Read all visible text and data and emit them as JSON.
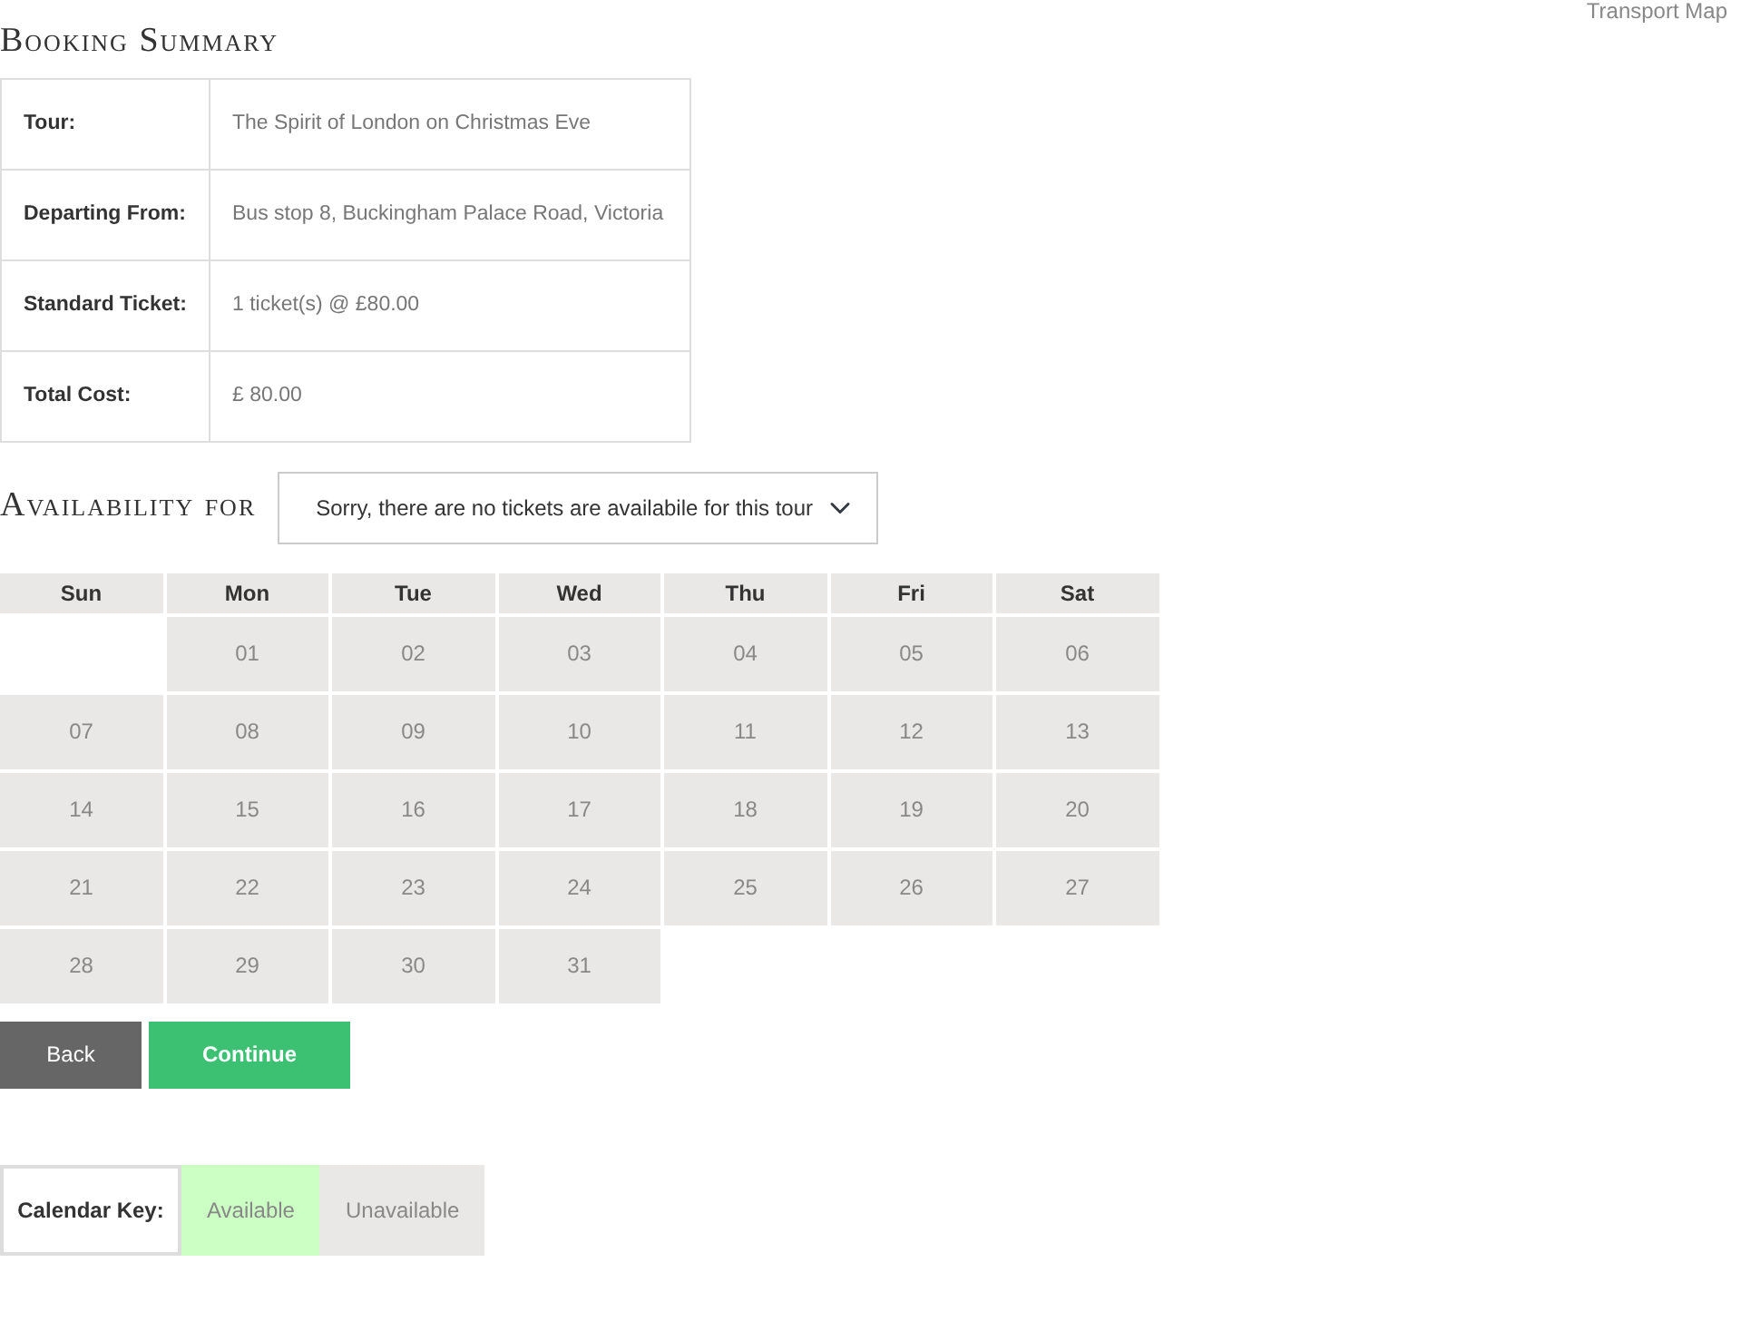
{
  "top_link": "Transport Map",
  "summary": {
    "title": "Booking Summary",
    "rows": [
      {
        "label": "Tour:",
        "value": "The Spirit of London on Christmas Eve"
      },
      {
        "label": "Departing From:",
        "value": "Bus stop 8, Buckingham Palace Road, Victoria"
      },
      {
        "label": "Standard Ticket:",
        "value": "1 ticket(s) @ £80.00"
      },
      {
        "label": "Total Cost:",
        "value": "£ 80.00"
      }
    ]
  },
  "availability": {
    "title": "Availability for",
    "select_value": "Sorry, there are no tickets are availabile for this tour"
  },
  "calendar": {
    "days": [
      "Sun",
      "Mon",
      "Tue",
      "Wed",
      "Thu",
      "Fri",
      "Sat"
    ],
    "weeks": [
      [
        {
          "kind": "empty"
        },
        {
          "kind": "day",
          "label": "01",
          "available": false
        },
        {
          "kind": "day",
          "label": "02",
          "available": false
        },
        {
          "kind": "day",
          "label": "03",
          "available": false
        },
        {
          "kind": "day",
          "label": "04",
          "available": false
        },
        {
          "kind": "day",
          "label": "05",
          "available": false
        },
        {
          "kind": "day",
          "label": "06",
          "available": false
        }
      ],
      [
        {
          "kind": "day",
          "label": "07",
          "available": false
        },
        {
          "kind": "day",
          "label": "08",
          "available": false
        },
        {
          "kind": "day",
          "label": "09",
          "available": false
        },
        {
          "kind": "day",
          "label": "10",
          "available": false
        },
        {
          "kind": "day",
          "label": "11",
          "available": false
        },
        {
          "kind": "day",
          "label": "12",
          "available": false
        },
        {
          "kind": "day",
          "label": "13",
          "available": false
        }
      ],
      [
        {
          "kind": "day",
          "label": "14",
          "available": false
        },
        {
          "kind": "day",
          "label": "15",
          "available": false
        },
        {
          "kind": "day",
          "label": "16",
          "available": false
        },
        {
          "kind": "day",
          "label": "17",
          "available": false
        },
        {
          "kind": "day",
          "label": "18",
          "available": false
        },
        {
          "kind": "day",
          "label": "19",
          "available": false
        },
        {
          "kind": "day",
          "label": "20",
          "available": false
        }
      ],
      [
        {
          "kind": "day",
          "label": "21",
          "available": false
        },
        {
          "kind": "day",
          "label": "22",
          "available": false
        },
        {
          "kind": "day",
          "label": "23",
          "available": false
        },
        {
          "kind": "day",
          "label": "24",
          "available": false
        },
        {
          "kind": "day",
          "label": "25",
          "available": false
        },
        {
          "kind": "day",
          "label": "26",
          "available": false
        },
        {
          "kind": "day",
          "label": "27",
          "available": false
        }
      ],
      [
        {
          "kind": "day",
          "label": "28",
          "available": false
        },
        {
          "kind": "day",
          "label": "29",
          "available": false
        },
        {
          "kind": "day",
          "label": "30",
          "available": false
        },
        {
          "kind": "day",
          "label": "31",
          "available": false
        }
      ]
    ]
  },
  "buttons": [
    {
      "label": "Back",
      "kind": "secondary"
    },
    {
      "label": "Continue",
      "kind": "primary"
    }
  ],
  "key": {
    "label": "Calendar Key:",
    "items": [
      {
        "label": "Available",
        "available": true
      },
      {
        "label": "Unavailable",
        "available": false
      }
    ]
  }
}
